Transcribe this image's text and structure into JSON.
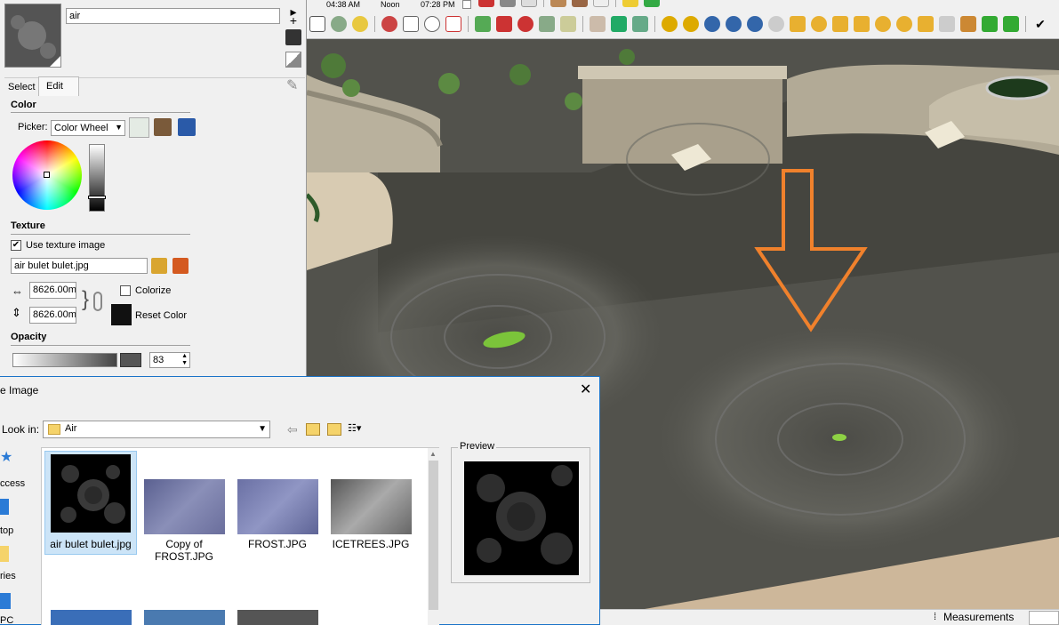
{
  "toolbar": {
    "time_start": "04:38 AM",
    "time_mid": "Noon",
    "time_end": "07:28 PM"
  },
  "materials": {
    "name_value": "air",
    "tabs": [
      "Select",
      "Edit"
    ],
    "active_tab": "Edit",
    "color_section": "Color",
    "picker_label": "Picker:",
    "picker_value": "Color Wheel",
    "texture_section": "Texture",
    "use_texture_label": "Use texture image",
    "use_texture_checked": true,
    "texture_file": "air bulet bulet.jpg",
    "width_value": "8626.00m",
    "height_value": "8626.00m",
    "colorize_label": "Colorize",
    "reset_color_label": "Reset Color",
    "opacity_section": "Opacity",
    "opacity_value": "83",
    "colors": {
      "swatch": "#e4ebe4",
      "reset_color": "#111111"
    }
  },
  "dialog": {
    "title_fragment": "e Image",
    "look_in_label": "Look in:",
    "look_in_value": "Air",
    "preview_label": "Preview",
    "places": [
      "ccess",
      "top",
      "ries",
      "PC"
    ],
    "files": [
      {
        "label": "air bulet bulet.jpg",
        "selected": true
      },
      {
        "label": "Copy of FROST.JPG",
        "selected": false
      },
      {
        "label": "FROST.JPG",
        "selected": false
      },
      {
        "label": "ICETREES.JPG",
        "selected": false
      }
    ]
  },
  "statusbar": {
    "measurements_label": "Measurements"
  }
}
